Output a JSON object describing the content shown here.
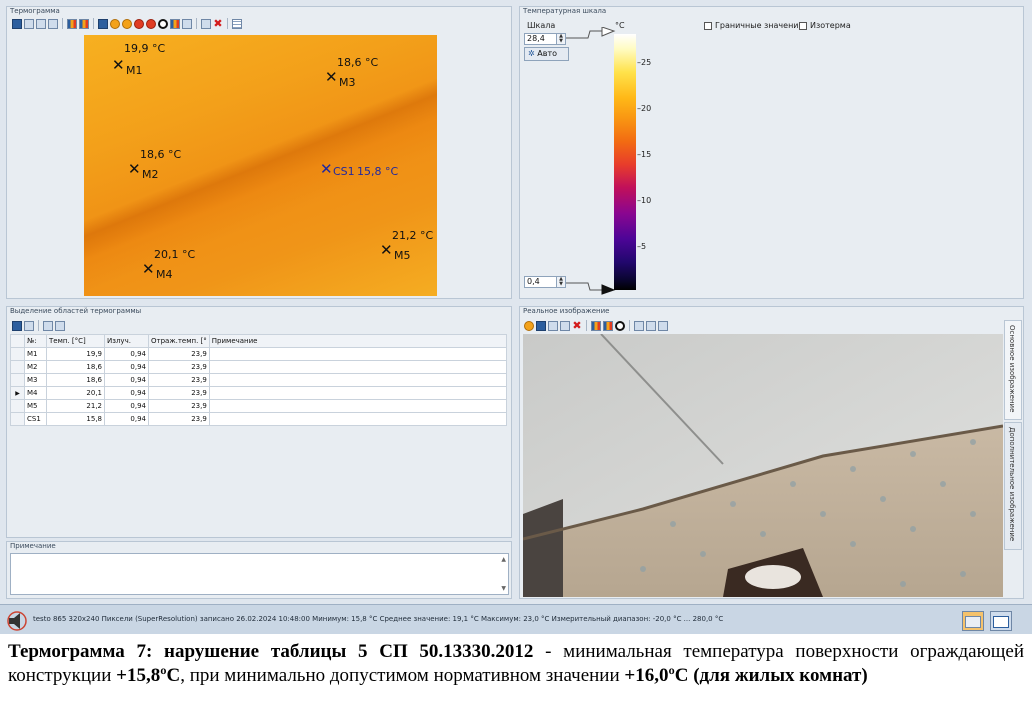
{
  "thermogram_panel": {
    "title": "Термограмма"
  },
  "markers": [
    {
      "id": "M1",
      "temp": "19,9 °C"
    },
    {
      "id": "M3",
      "temp": "18,6 °C"
    },
    {
      "id": "M2",
      "temp": "18,6 °C"
    },
    {
      "id": "CS1",
      "temp": "15,8 °C"
    },
    {
      "id": "M5",
      "temp": "21,2 °C"
    },
    {
      "id": "M4",
      "temp": "20,1 °C"
    }
  ],
  "scale_panel": {
    "title": "Температурная шкала",
    "scale_label": "Шкала",
    "max_value": "28,4",
    "min_value": "0,4",
    "auto_button": "Авто",
    "unit": "°C",
    "ticks": [
      "25",
      "20",
      "15",
      "10",
      "5"
    ],
    "limits_checkbox": "Граничные значения",
    "isotherm_checkbox": "Изотерма"
  },
  "regions_panel": {
    "title": "Выделение областей термограммы",
    "columns": [
      "№:",
      "Темп. [°C]",
      "Излуч.",
      "Отраж.темп. [°",
      "Примечание"
    ],
    "rows": [
      [
        "M1",
        "19,9",
        "0,94",
        "23,9",
        ""
      ],
      [
        "M2",
        "18,6",
        "0,94",
        "23,9",
        ""
      ],
      [
        "M3",
        "18,6",
        "0,94",
        "23,9",
        ""
      ],
      [
        "M4",
        "20,1",
        "0,94",
        "23,9",
        ""
      ],
      [
        "M5",
        "21,2",
        "0,94",
        "23,9",
        ""
      ],
      [
        "CS1",
        "15,8",
        "0,94",
        "23,9",
        ""
      ]
    ],
    "selected_row_marker": "▶"
  },
  "note_panel": {
    "title": "Примечание"
  },
  "photo_panel": {
    "title": "Реальное изображение",
    "tab_main": "Основное изображение",
    "tab_extra": "Дополнительное изображение"
  },
  "status_bar": {
    "text": "testo 865 320x240 Пиксели (SuperResolution) записано 26.02.2024 10:48:00 Минимум: 15,8 °C Среднее значение: 19,1 °C Максимум: 23,0 °C Измерительный диапазон: -20,0 °C ... 280,0 °C"
  },
  "caption": {
    "part1": "Термограмма  7: нарушение таблицы 5 СП 50.13330.2012",
    "part2": " - минимальная температура поверхности ограждающей конструкции ",
    "part3": "+15,8ºС",
    "part4": ", при минимально допустимом нормативном значении ",
    "part5": "+16,0ºС (для жилых комнат)"
  },
  "colors": {
    "accent": "#2c5e9e",
    "panel": "#e8edf2",
    "thermo": "#f3a01a"
  }
}
